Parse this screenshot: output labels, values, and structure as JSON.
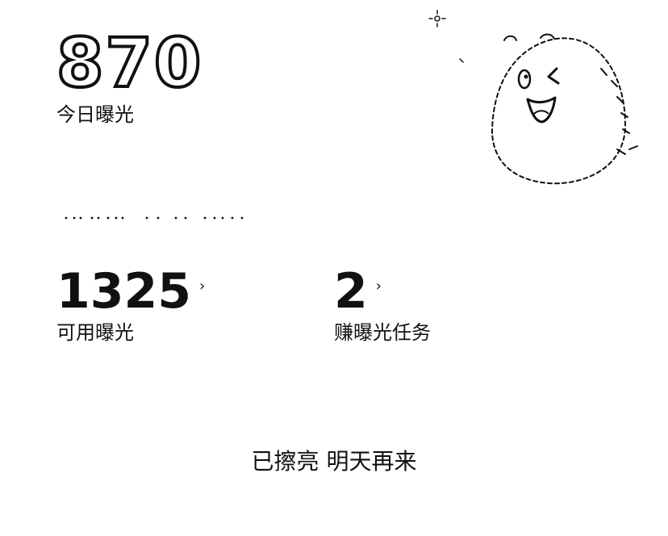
{
  "today": {
    "value": "870",
    "label": "今日曝光"
  },
  "stats": {
    "available": {
      "value": "1325",
      "label": "可用曝光"
    },
    "tasks": {
      "value": "2",
      "label": "赚曝光任务"
    },
    "chevron": "›"
  },
  "footer": {
    "status": "已擦亮 明天再来"
  },
  "icons": {
    "mascot": "winking-mascot-icon",
    "arrow": "chevron-right-icon"
  },
  "colors": {
    "text": "#111111",
    "background": "#ffffff"
  }
}
